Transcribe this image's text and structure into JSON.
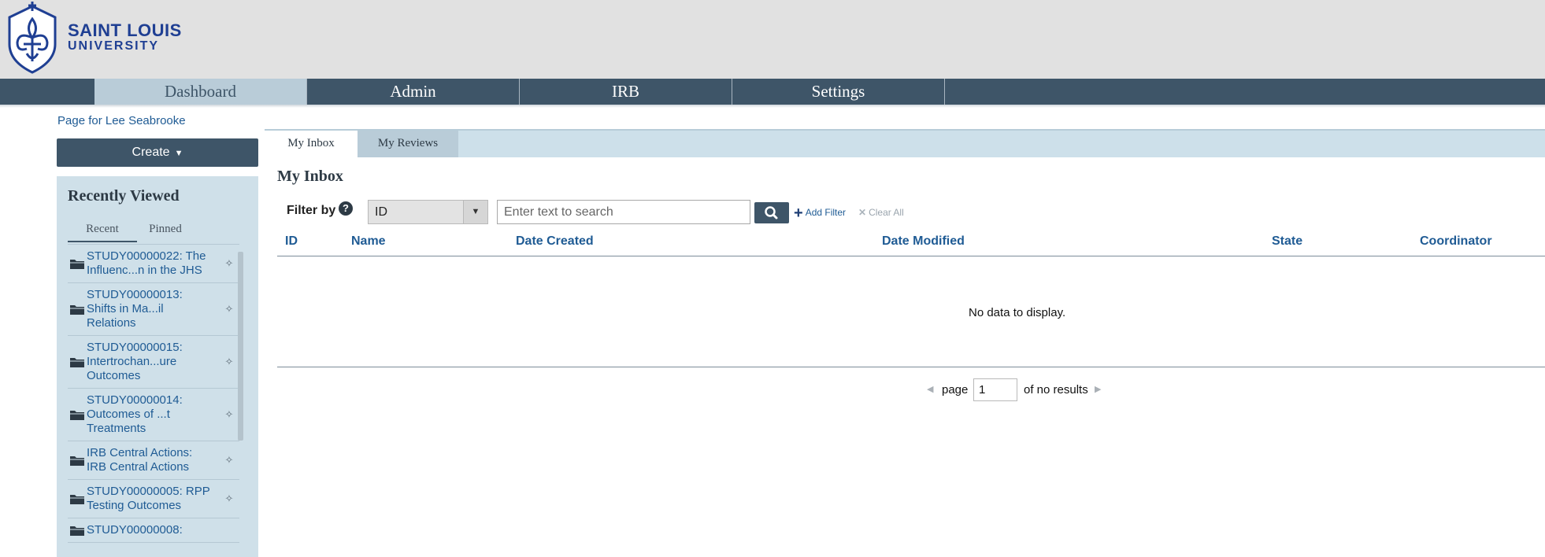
{
  "brand": {
    "line1": "SAINT LOUIS",
    "line2": "UNIVERSITY",
    "colors": {
      "brand_blue": "#1f3f93",
      "nav_bg": "#3e5568",
      "active_tab": "#b9ccd8",
      "link": "#1f5b94"
    }
  },
  "nav": {
    "items": [
      {
        "label": "Dashboard",
        "active": true
      },
      {
        "label": "Admin",
        "active": false
      },
      {
        "label": "IRB",
        "active": false
      },
      {
        "label": "Settings",
        "active": false
      }
    ]
  },
  "page_owner": "Page for Lee Seabrooke",
  "sidebar": {
    "create_label": "Create",
    "recently_viewed_title": "Recently Viewed",
    "tabs": [
      {
        "label": "Recent",
        "active": true
      },
      {
        "label": "Pinned",
        "active": false
      }
    ],
    "items": [
      {
        "text": "STUDY00000022: The\nInfluenc...n in the JHS",
        "icon": "folder-icon"
      },
      {
        "text": "STUDY00000013:\nShifts in Ma...il\nRelations",
        "icon": "folder-icon"
      },
      {
        "text": "STUDY00000015:\nIntertrochan...ure\nOutcomes",
        "icon": "folder-icon"
      },
      {
        "text": "STUDY00000014:\nOutcomes of ...t\nTreatments",
        "icon": "folder-icon"
      },
      {
        "text": "IRB Central Actions:\nIRB Central Actions",
        "icon": "folder-icon"
      },
      {
        "text": "STUDY00000005: RPP\nTesting Outcomes",
        "icon": "folder-icon"
      },
      {
        "text": "STUDY00000008:",
        "icon": "folder-icon"
      }
    ]
  },
  "main": {
    "tabs": [
      {
        "label": "My Inbox",
        "active": true
      },
      {
        "label": "My Reviews",
        "active": false
      }
    ],
    "title": "My Inbox",
    "filter": {
      "label": "Filter by",
      "selected": "ID",
      "placeholder": "Enter text to search",
      "value": "",
      "add_filter": "Add Filter",
      "clear_all": "Clear All"
    },
    "table": {
      "columns": [
        "ID",
        "Name",
        "Date Created",
        "Date Modified",
        "State",
        "Coordinator"
      ],
      "rows": [],
      "empty_message": "No data to display."
    },
    "pager": {
      "page_label": "page",
      "page_value": "1",
      "of_label": "of no results"
    }
  }
}
